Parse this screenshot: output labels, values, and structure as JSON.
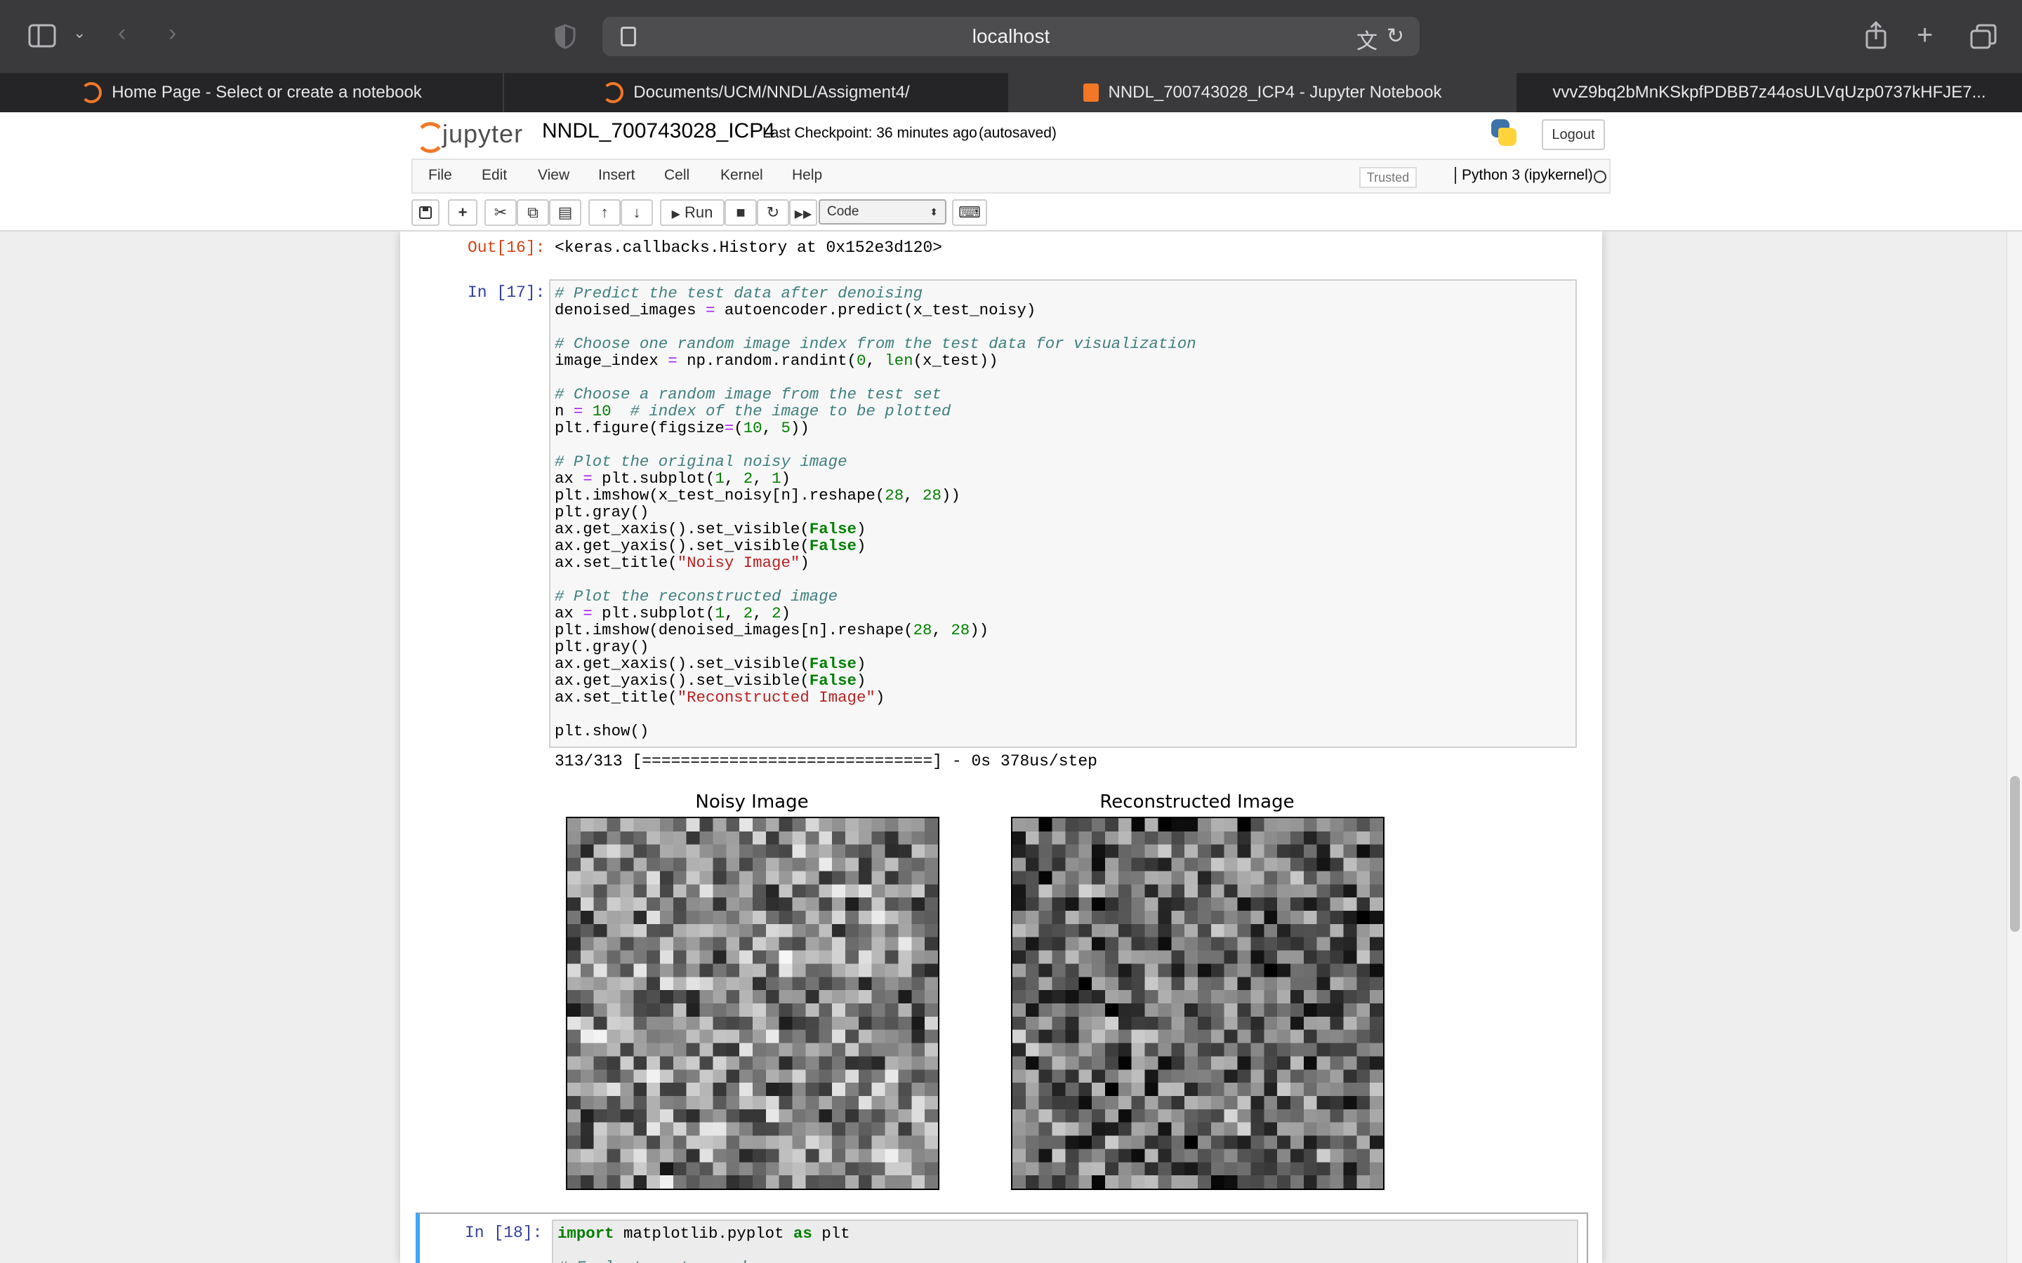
{
  "browser": {
    "address": "localhost",
    "tabs": [
      {
        "label": "Home Page - Select or create a notebook",
        "favicon": "jupyter-icon"
      },
      {
        "label": "Documents/UCM/NNDL/Assigment4/",
        "favicon": "jupyter-icon"
      },
      {
        "label": "NNDL_700743028_ICP4 - Jupyter Notebook",
        "favicon": "notebook-icon",
        "active": true
      },
      {
        "label": "vvvZ9bq2bMnKSkpfPDBB7z44osULVqUzp0737kHFJE7...",
        "favicon": ""
      }
    ]
  },
  "jupyter": {
    "logo_text": "jupyter",
    "notebook_name": "NNDL_700743028_ICP4",
    "checkpoint": "Last Checkpoint: 36 minutes ago",
    "autosave": "(autosaved)",
    "logout": "Logout",
    "menu": [
      "File",
      "Edit",
      "View",
      "Insert",
      "Cell",
      "Kernel",
      "Help"
    ],
    "trusted": "Trusted",
    "kernel": "Python 3 (ipykernel)",
    "toolbar": {
      "run": "Run",
      "cell_type": "Code"
    }
  },
  "cells": {
    "out16_prompt": "Out[16]:",
    "out16_text": "<keras.callbacks.History at 0x152e3d120>",
    "in17_prompt": "In [17]:",
    "in17_stdout": "313/313 [==============================] - 0s 378us/step",
    "in18_prompt": "In [18]:"
  },
  "figure": {
    "left_title": "Noisy Image",
    "right_title": "Reconstructed Image"
  },
  "colors": {
    "jupyter_orange": "#f37726",
    "selected_cell": "#42a5f5"
  }
}
